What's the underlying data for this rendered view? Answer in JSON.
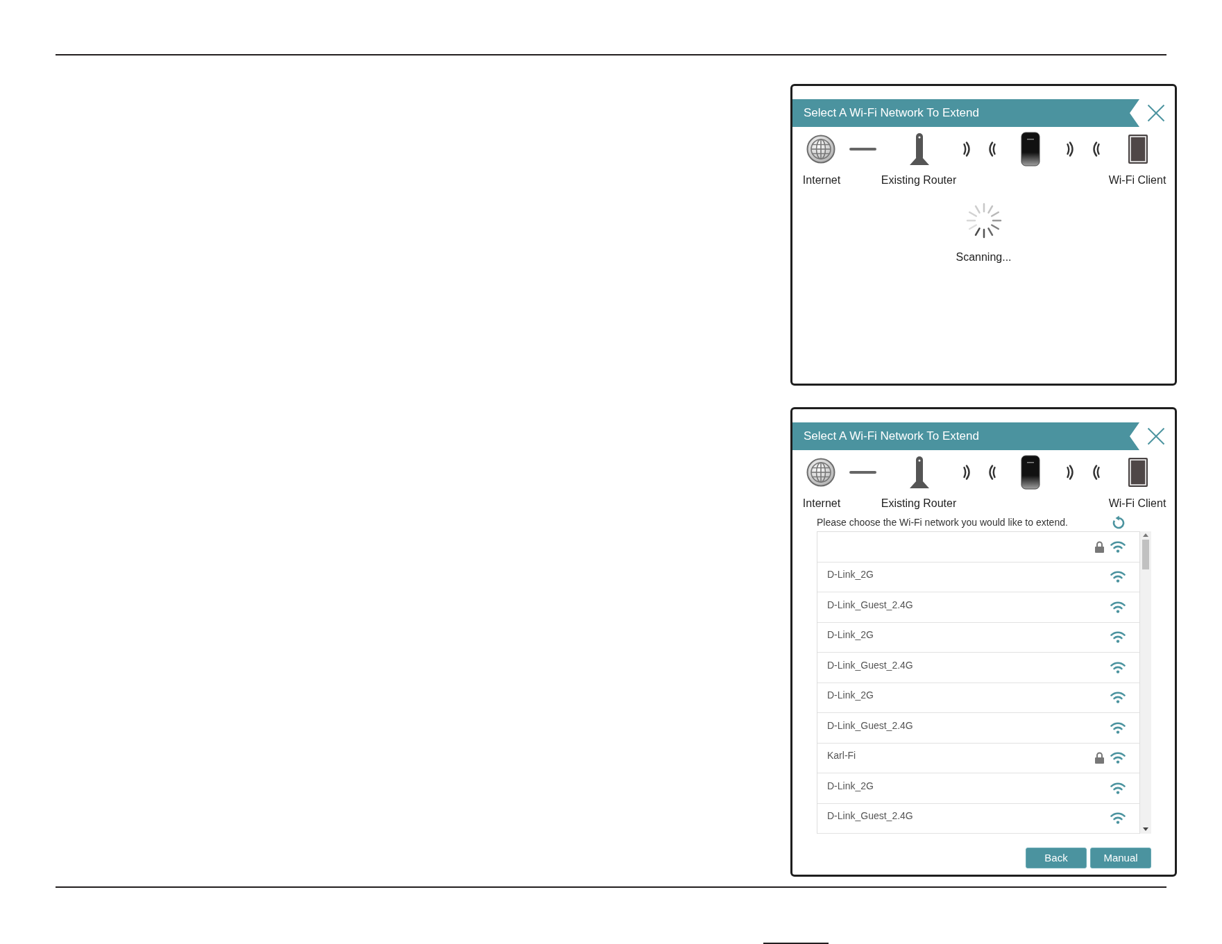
{
  "panels": [
    {
      "kind": "scanning",
      "title": "Select A Wi-Fi Network To Extend",
      "diagram": {
        "internet_label": "Internet",
        "router_label": "Existing Router",
        "client_label": "Wi-Fi Client"
      },
      "status": "Scanning..."
    },
    {
      "kind": "network_list",
      "title": "Select A Wi-Fi Network To Extend",
      "diagram": {
        "internet_label": "Internet",
        "router_label": "Existing Router",
        "client_label": "Wi-Fi Client"
      },
      "instruction": "Please choose the Wi-Fi network you would like to extend.",
      "networks": [
        {
          "locked": true,
          "selected": false
        },
        {
          "name": "D-Link_2G",
          "locked": false,
          "selected": false
        },
        {
          "name": "D-Link_Guest_2.4G",
          "locked": false,
          "selected": false
        },
        {
          "name": "D-Link_2G",
          "locked": false,
          "selected": false
        },
        {
          "name": "D-Link_Guest_2.4G",
          "locked": false,
          "selected": false
        },
        {
          "name": "D-Link_2G",
          "locked": false,
          "selected": false
        },
        {
          "name": "D-Link_Guest_2.4G",
          "locked": false,
          "selected": false
        },
        {
          "name": "Karl-Fi",
          "locked": true,
          "selected": false
        },
        {
          "name": "D-Link_2G",
          "locked": false,
          "selected": false
        },
        {
          "name": "D-Link_Guest_2.4G",
          "locked": false,
          "selected": false
        }
      ],
      "buttons": [
        "Back",
        "Manual"
      ]
    }
  ]
}
